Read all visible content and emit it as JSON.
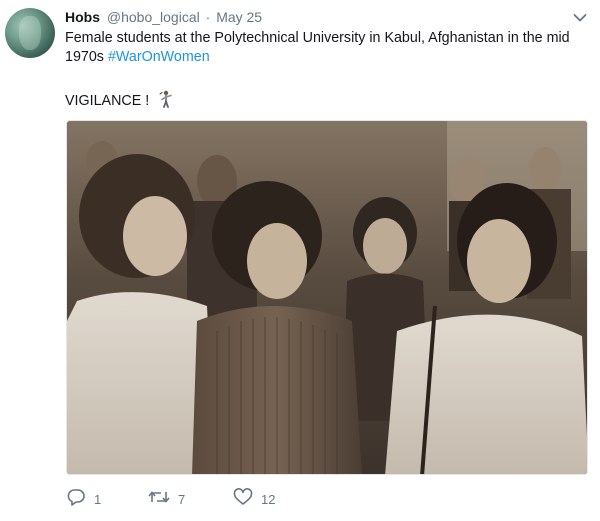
{
  "tweet": {
    "author_name": "Hobs",
    "handle": "@hobo_logical",
    "separator": "·",
    "date": "May 25",
    "text_main": "Female students at the Polytechnical University in Kabul, Afghanistan in the mid 1970s",
    "hashtag": "#WarOnWomen",
    "text_second": "VIGILANCE !",
    "emoji": "man-icon"
  },
  "actions": {
    "reply_count": "1",
    "retweet_count": "7",
    "like_count": "12"
  },
  "colors": {
    "link": "#1b95e0",
    "muted": "#657786",
    "text": "#14171a"
  }
}
